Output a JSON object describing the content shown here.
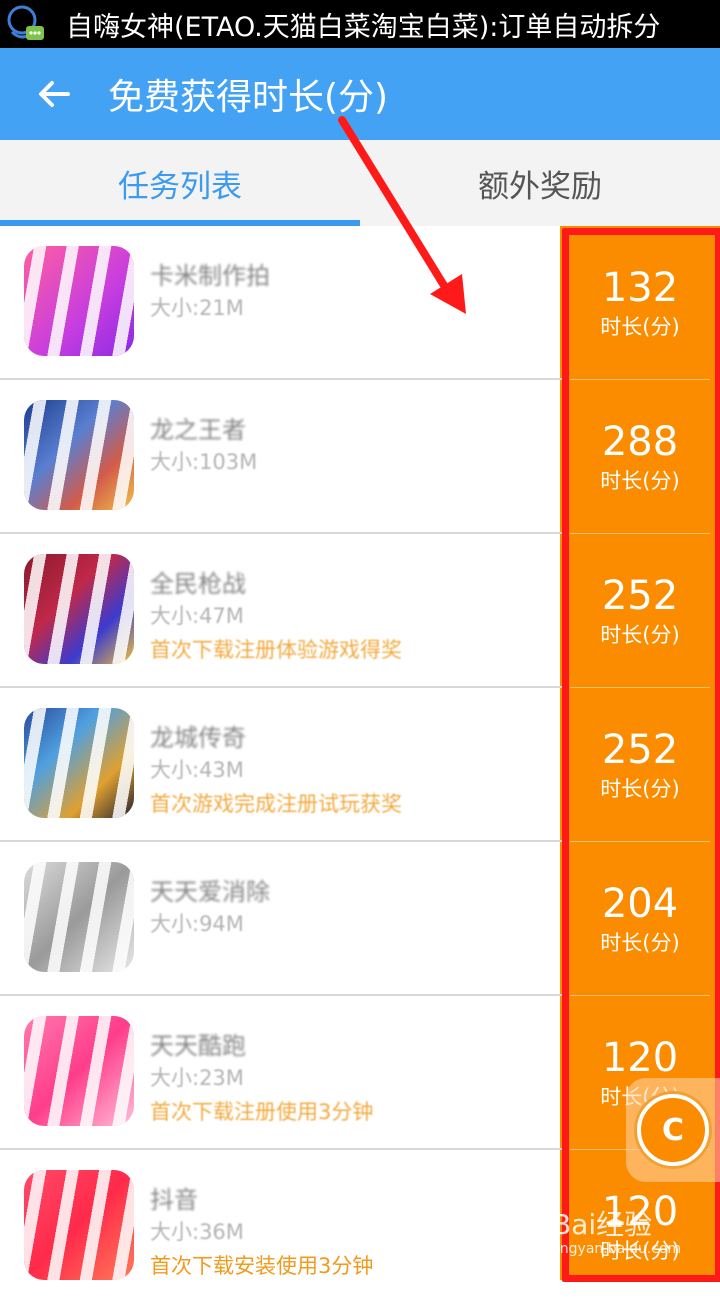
{
  "statusbar": {
    "title": "自嗨女神(ETAO.天猫白菜淘宝白菜):订单自动拆分",
    "icon": "chat-app-icon"
  },
  "appbar": {
    "back_icon": "arrow-left-icon",
    "title": "免费获得时长(分)"
  },
  "tabs": [
    {
      "label": "任务列表",
      "active": true
    },
    {
      "label": "额外奖励",
      "active": false
    }
  ],
  "tasks": [
    {
      "name": "卡米制作拍",
      "size": "大小:21M",
      "note": "",
      "reward": "132",
      "unit": "时长(分)"
    },
    {
      "name": "龙之王者",
      "size": "大小:103M",
      "note": "",
      "reward": "288",
      "unit": "时长(分)"
    },
    {
      "name": "全民枪战",
      "size": "大小:47M",
      "note": "首次下载注册体验游戏得奖",
      "reward": "252",
      "unit": "时长(分)"
    },
    {
      "name": "龙城传奇",
      "size": "大小:43M",
      "note": "首次游戏完成注册试玩获奖",
      "reward": "252",
      "unit": "时长(分)"
    },
    {
      "name": "天天爱消除",
      "size": "大小:94M",
      "note": "",
      "reward": "204",
      "unit": "时长(分)"
    },
    {
      "name": "天天酷跑",
      "size": "大小:23M",
      "note": "首次下载注册使用3分钟",
      "reward": "120",
      "unit": "时长(分)"
    },
    {
      "name": "抖音",
      "size": "大小:36M",
      "note": "首次下载安装使用3分钟",
      "reward": "120",
      "unit": "时长(分)"
    }
  ],
  "floating_button": {
    "icon": "c-logo-icon",
    "letter": "C"
  },
  "watermark": {
    "main": "Bai经验",
    "sub": "jingyan.baidu.com"
  },
  "colors": {
    "statusbar": "#000000",
    "appbar": "#44a2f5",
    "tab_active": "#3b9bf0",
    "reward_bg": "#fb8c00",
    "highlight_border": "#ff1a1a",
    "note_text": "#f19a1c"
  }
}
